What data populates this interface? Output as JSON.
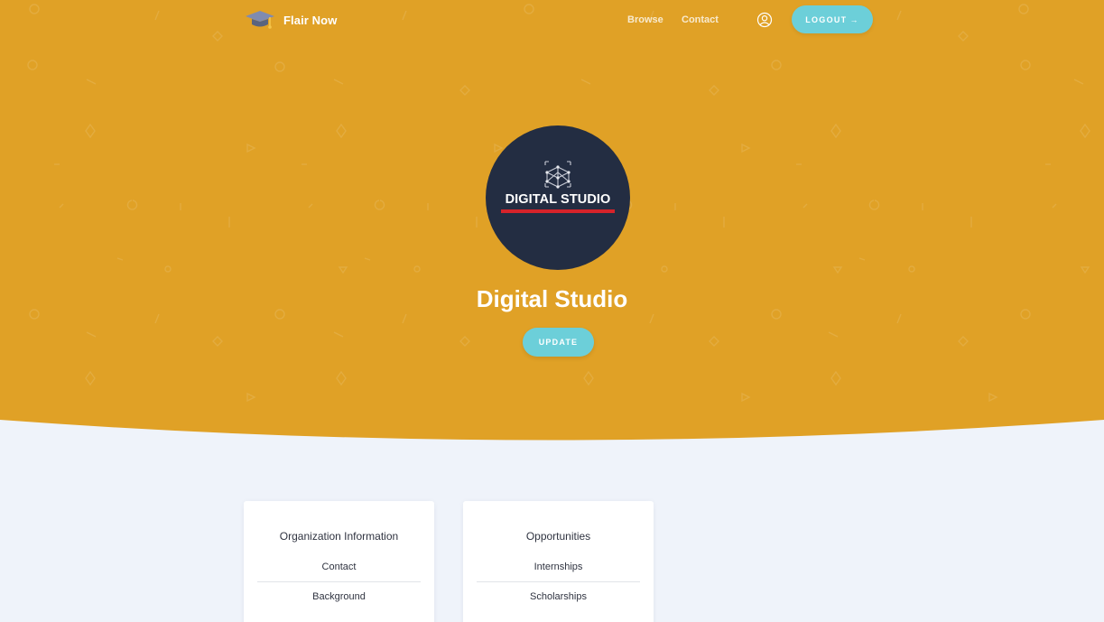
{
  "nav": {
    "brand": "Flair Now",
    "links": [
      "Browse",
      "Contact"
    ],
    "logout_label": "LOGOUT",
    "logout_arrow": "→",
    "user_icon": "user-circle-icon",
    "brand_icon": "graduation-cap-icon"
  },
  "profile": {
    "logo_text": "DIGITAL STUDIO",
    "name": "Digital Studio",
    "update_label": "UPDATE"
  },
  "cards": [
    {
      "title": "Organization Information",
      "items": [
        "Contact",
        "Background"
      ]
    },
    {
      "title": "Opportunities",
      "items": [
        "Internships",
        "Scholarships"
      ]
    }
  ],
  "colors": {
    "hero": "#e0a126",
    "accent": "#6ccfd9",
    "avatar_bg": "#232d42",
    "page_bg": "#eff3fa",
    "logo_underline": "#d6232a"
  }
}
